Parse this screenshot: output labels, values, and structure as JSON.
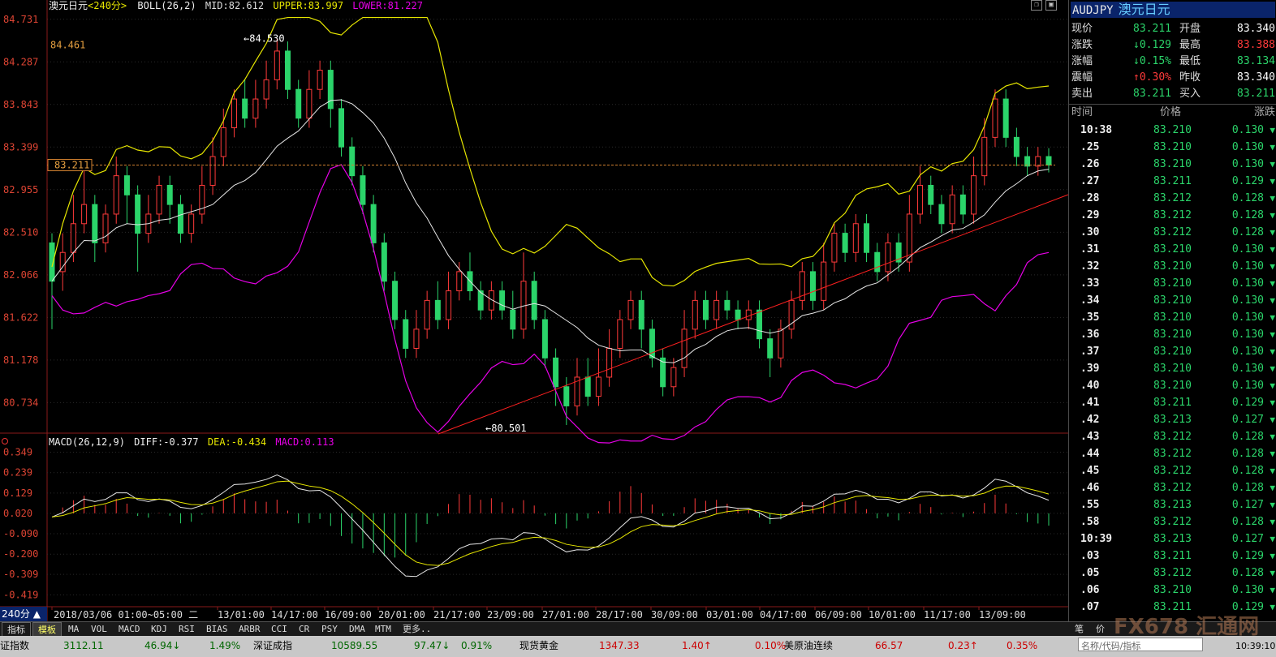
{
  "chart_header": {
    "title": "澳元日元",
    "period": "<240分>",
    "indicator": "BOLL(26,2)",
    "mid": "MID:82.612",
    "upper": "UPPER:83.997",
    "lower": "LOWER:81.227"
  },
  "macd_header": {
    "label": "MACD(26,12,9)",
    "diff": "DIFF:-0.377",
    "dea": "DEA:-0.434",
    "macd": "MACD:0.113"
  },
  "price_axis": [
    "84.731",
    "84.287",
    "83.843",
    "83.399",
    "82.955",
    "82.510",
    "82.066",
    "81.622",
    "81.178",
    "80.734"
  ],
  "macd_axis": [
    "0.349",
    "0.239",
    "0.129",
    "0.020",
    "-0.090",
    "-0.200",
    "-0.309",
    "-0.419"
  ],
  "current_price_tag": "83.211",
  "annotations": {
    "high": "84.530",
    "low": "80.501",
    "left_high": "84.461"
  },
  "period_label": "240分",
  "date_axis": [
    "2018/03/06 01:00~05:00 二",
    "13/01:00",
    "14/17:00",
    "16/09:00",
    "20/01:00",
    "21/17:00",
    "23/09:00",
    "27/01:00",
    "28/17:00",
    "30/09:00",
    "03/01:00",
    "04/17:00",
    "06/09:00",
    "10/01:00",
    "11/17:00",
    "13/09:00"
  ],
  "sidebar": {
    "symbol": "AUDJPY",
    "symbol_cn": "澳元日元",
    "quote_rows": [
      {
        "l1": "现价",
        "v1": "83.211",
        "a1": "",
        "l2": "开盘",
        "v2": "83.340",
        "c2": "#ffffff"
      },
      {
        "l1": "涨跌",
        "v1": "0.129",
        "a1": "↓",
        "l2": "最高",
        "v2": "83.388",
        "c2": "#ff3a3a"
      },
      {
        "l1": "涨幅",
        "v1": "0.15%",
        "a1": "↓",
        "l2": "最低",
        "v2": "83.134",
        "c2": "#2bd46a"
      },
      {
        "l1": "震幅",
        "v1": "0.30%",
        "a1": "↑",
        "l2": "昨收",
        "v2": "83.340",
        "c2": "#ffffff"
      },
      {
        "l1": "卖出",
        "v1": "83.211",
        "a1": "",
        "l2": "买入",
        "v2": "83.211",
        "c2": "#2bd46a"
      }
    ],
    "table_headers": [
      "时间",
      "价格",
      "涨跌"
    ],
    "ticks": [
      {
        "t": "10:38",
        "p": "83.210",
        "c": "0.130"
      },
      {
        "t": ".25",
        "p": "83.210",
        "c": "0.130"
      },
      {
        "t": ".26",
        "p": "83.210",
        "c": "0.130"
      },
      {
        "t": ".27",
        "p": "83.211",
        "c": "0.129"
      },
      {
        "t": ".28",
        "p": "83.212",
        "c": "0.128"
      },
      {
        "t": ".29",
        "p": "83.212",
        "c": "0.128"
      },
      {
        "t": ".30",
        "p": "83.212",
        "c": "0.128"
      },
      {
        "t": ".31",
        "p": "83.210",
        "c": "0.130"
      },
      {
        "t": ".32",
        "p": "83.210",
        "c": "0.130"
      },
      {
        "t": ".33",
        "p": "83.210",
        "c": "0.130"
      },
      {
        "t": ".34",
        "p": "83.210",
        "c": "0.130"
      },
      {
        "t": ".35",
        "p": "83.210",
        "c": "0.130"
      },
      {
        "t": ".36",
        "p": "83.210",
        "c": "0.130"
      },
      {
        "t": ".37",
        "p": "83.210",
        "c": "0.130"
      },
      {
        "t": ".39",
        "p": "83.210",
        "c": "0.130"
      },
      {
        "t": ".40",
        "p": "83.210",
        "c": "0.130"
      },
      {
        "t": ".41",
        "p": "83.211",
        "c": "0.129"
      },
      {
        "t": ".42",
        "p": "83.213",
        "c": "0.127"
      },
      {
        "t": ".43",
        "p": "83.212",
        "c": "0.128"
      },
      {
        "t": ".44",
        "p": "83.212",
        "c": "0.128"
      },
      {
        "t": ".45",
        "p": "83.212",
        "c": "0.128"
      },
      {
        "t": ".46",
        "p": "83.212",
        "c": "0.128"
      },
      {
        "t": ".55",
        "p": "83.213",
        "c": "0.127"
      },
      {
        "t": ".58",
        "p": "83.212",
        "c": "0.128"
      },
      {
        "t": "10:39",
        "p": "83.213",
        "c": "0.127"
      },
      {
        "t": ".03",
        "p": "83.211",
        "c": "0.129"
      },
      {
        "t": ".05",
        "p": "83.212",
        "c": "0.128"
      },
      {
        "t": ".06",
        "p": "83.210",
        "c": "0.130"
      },
      {
        "t": ".07",
        "p": "83.211",
        "c": "0.129"
      }
    ]
  },
  "toolbar": {
    "tabs": [
      "指标",
      "模板"
    ],
    "items": [
      "MA",
      "VOL",
      "MACD",
      "KDJ",
      "RSI",
      "BIAS",
      "ARBR",
      "CCI",
      "CR",
      "PSY",
      "DMA",
      "MTM",
      "更多.."
    ],
    "right": [
      "笔",
      "价"
    ]
  },
  "ticker": [
    {
      "text": "证指数",
      "c": "#000"
    },
    {
      "text": "3112.11",
      "c": "#060"
    },
    {
      "text": "46.94↓",
      "c": "#060"
    },
    {
      "text": "1.49%",
      "c": "#060"
    },
    {
      "text": "深证成指",
      "c": "#000"
    },
    {
      "text": "10589.55",
      "c": "#060"
    },
    {
      "text": "97.47↓",
      "c": "#060"
    },
    {
      "text": "0.91%",
      "c": "#060"
    },
    {
      "text": "现货黄金",
      "c": "#000"
    },
    {
      "text": "1347.33",
      "c": "#c00"
    },
    {
      "text": "1.40↑",
      "c": "#c00"
    },
    {
      "text": "0.10%",
      "c": "#c00"
    },
    {
      "text": "美原油连续",
      "c": "#000"
    },
    {
      "text": "66.57",
      "c": "#c00"
    },
    {
      "text": "0.23↑",
      "c": "#c00"
    },
    {
      "text": "0.35%",
      "c": "#c00"
    }
  ],
  "search_placeholder": "名称/代码/指标",
  "watermark": "FX678 汇通网",
  "clock": "10:39:10",
  "colors": {
    "up": "#ff3a3a",
    "down": "#2bd46a",
    "upper": "#e6e600",
    "lower": "#e600e6",
    "mid": "#e6e6e6",
    "trend": "#ff2020"
  },
  "chart_data": {
    "type": "candlestick",
    "ylim": [
      80.5,
      84.8
    ],
    "candles": [
      [
        82.4,
        82.0,
        81.5,
        82.5
      ],
      [
        82.1,
        82.3,
        81.9,
        82.5
      ],
      [
        82.3,
        82.6,
        82.2,
        82.9
      ],
      [
        82.6,
        82.8,
        82.5,
        83.2
      ],
      [
        82.8,
        82.4,
        82.2,
        82.9
      ],
      [
        82.4,
        82.7,
        82.3,
        82.8
      ],
      [
        82.7,
        83.1,
        82.6,
        83.3
      ],
      [
        83.1,
        82.9,
        82.6,
        83.2
      ],
      [
        82.9,
        82.5,
        82.1,
        83.0
      ],
      [
        82.5,
        82.7,
        82.4,
        82.9
      ],
      [
        82.7,
        83.0,
        82.6,
        83.1
      ],
      [
        83.0,
        82.8,
        82.6,
        83.1
      ],
      [
        82.8,
        82.5,
        82.4,
        82.9
      ],
      [
        82.5,
        82.7,
        82.4,
        82.8
      ],
      [
        82.7,
        83.0,
        82.6,
        83.2
      ],
      [
        83.0,
        83.3,
        82.9,
        83.5
      ],
      [
        83.3,
        83.6,
        83.2,
        83.8
      ],
      [
        83.6,
        83.9,
        83.5,
        84.0
      ],
      [
        83.9,
        83.7,
        83.6,
        84.1
      ],
      [
        83.7,
        83.9,
        83.6,
        84.1
      ],
      [
        83.9,
        84.1,
        83.8,
        84.3
      ],
      [
        84.1,
        84.4,
        84.0,
        84.53
      ],
      [
        84.4,
        84.0,
        83.9,
        84.5
      ],
      [
        84.0,
        83.7,
        83.6,
        84.1
      ],
      [
        83.7,
        84.0,
        83.6,
        84.2
      ],
      [
        84.0,
        84.2,
        83.9,
        84.3
      ],
      [
        84.2,
        83.8,
        83.6,
        84.3
      ],
      [
        83.8,
        83.4,
        83.3,
        83.9
      ],
      [
        83.4,
        83.1,
        83.0,
        83.5
      ],
      [
        83.1,
        82.8,
        82.7,
        83.2
      ],
      [
        82.8,
        82.4,
        82.3,
        82.9
      ],
      [
        82.4,
        82.0,
        81.9,
        82.5
      ],
      [
        82.0,
        81.6,
        81.5,
        82.1
      ],
      [
        81.6,
        81.3,
        81.2,
        81.7
      ],
      [
        81.3,
        81.5,
        81.2,
        81.7
      ],
      [
        81.5,
        81.8,
        81.4,
        81.9
      ],
      [
        81.8,
        81.6,
        81.5,
        82.0
      ],
      [
        81.6,
        81.9,
        81.5,
        82.1
      ],
      [
        81.9,
        82.1,
        81.8,
        82.2
      ],
      [
        82.1,
        81.9,
        81.8,
        82.3
      ],
      [
        81.9,
        81.7,
        81.6,
        82.0
      ],
      [
        81.7,
        81.9,
        81.6,
        82.0
      ],
      [
        81.9,
        81.7,
        81.6,
        82.0
      ],
      [
        81.7,
        81.5,
        81.4,
        81.9
      ],
      [
        81.5,
        82.0,
        81.4,
        82.3
      ],
      [
        82.0,
        81.6,
        81.5,
        82.1
      ],
      [
        81.6,
        81.2,
        81.1,
        81.7
      ],
      [
        81.2,
        80.9,
        80.7,
        81.3
      ],
      [
        80.9,
        80.7,
        80.501,
        81.0
      ],
      [
        80.7,
        81.0,
        80.6,
        81.2
      ],
      [
        81.0,
        80.8,
        80.7,
        81.2
      ],
      [
        80.8,
        81.0,
        80.7,
        81.3
      ],
      [
        81.0,
        81.3,
        80.9,
        81.5
      ],
      [
        81.3,
        81.6,
        81.2,
        81.7
      ],
      [
        81.6,
        81.8,
        81.5,
        81.9
      ],
      [
        81.8,
        81.5,
        81.3,
        81.9
      ],
      [
        81.5,
        81.2,
        81.1,
        81.6
      ],
      [
        81.2,
        80.9,
        80.8,
        81.3
      ],
      [
        80.9,
        81.1,
        80.8,
        81.2
      ],
      [
        81.1,
        81.5,
        81.0,
        81.7
      ],
      [
        81.5,
        81.8,
        81.4,
        81.9
      ],
      [
        81.8,
        81.6,
        81.5,
        81.9
      ],
      [
        81.6,
        81.8,
        81.5,
        81.9
      ],
      [
        81.8,
        81.7,
        81.6,
        81.9
      ],
      [
        81.7,
        81.6,
        81.5,
        81.8
      ],
      [
        81.6,
        81.7,
        81.5,
        81.8
      ],
      [
        81.7,
        81.4,
        81.3,
        81.8
      ],
      [
        81.4,
        81.2,
        81.0,
        81.5
      ],
      [
        81.2,
        81.5,
        81.1,
        81.6
      ],
      [
        81.5,
        81.8,
        81.4,
        81.9
      ],
      [
        81.8,
        82.1,
        81.7,
        82.2
      ],
      [
        82.1,
        81.8,
        81.7,
        82.2
      ],
      [
        81.8,
        82.2,
        81.7,
        82.4
      ],
      [
        82.2,
        82.5,
        82.1,
        82.6
      ],
      [
        82.5,
        82.3,
        82.2,
        82.6
      ],
      [
        82.3,
        82.6,
        82.2,
        82.7
      ],
      [
        82.6,
        82.3,
        82.2,
        82.7
      ],
      [
        82.3,
        82.1,
        82.0,
        82.4
      ],
      [
        82.1,
        82.4,
        82.0,
        82.5
      ],
      [
        82.4,
        82.2,
        82.1,
        82.5
      ],
      [
        82.2,
        82.7,
        82.1,
        82.9
      ],
      [
        82.7,
        83.0,
        82.6,
        83.2
      ],
      [
        83.0,
        82.8,
        82.7,
        83.1
      ],
      [
        82.8,
        82.6,
        82.5,
        82.9
      ],
      [
        82.6,
        82.9,
        82.5,
        83.0
      ],
      [
        82.9,
        82.7,
        82.6,
        83.0
      ],
      [
        82.7,
        83.1,
        82.6,
        83.3
      ],
      [
        83.1,
        83.5,
        83.0,
        83.7
      ],
      [
        83.5,
        83.9,
        83.4,
        84.0
      ],
      [
        83.9,
        83.5,
        83.4,
        84.0
      ],
      [
        83.5,
        83.3,
        83.2,
        83.6
      ],
      [
        83.3,
        83.2,
        83.1,
        83.4
      ],
      [
        83.2,
        83.3,
        83.1,
        83.4
      ],
      [
        83.3,
        83.211,
        83.134,
        83.388
      ]
    ]
  }
}
